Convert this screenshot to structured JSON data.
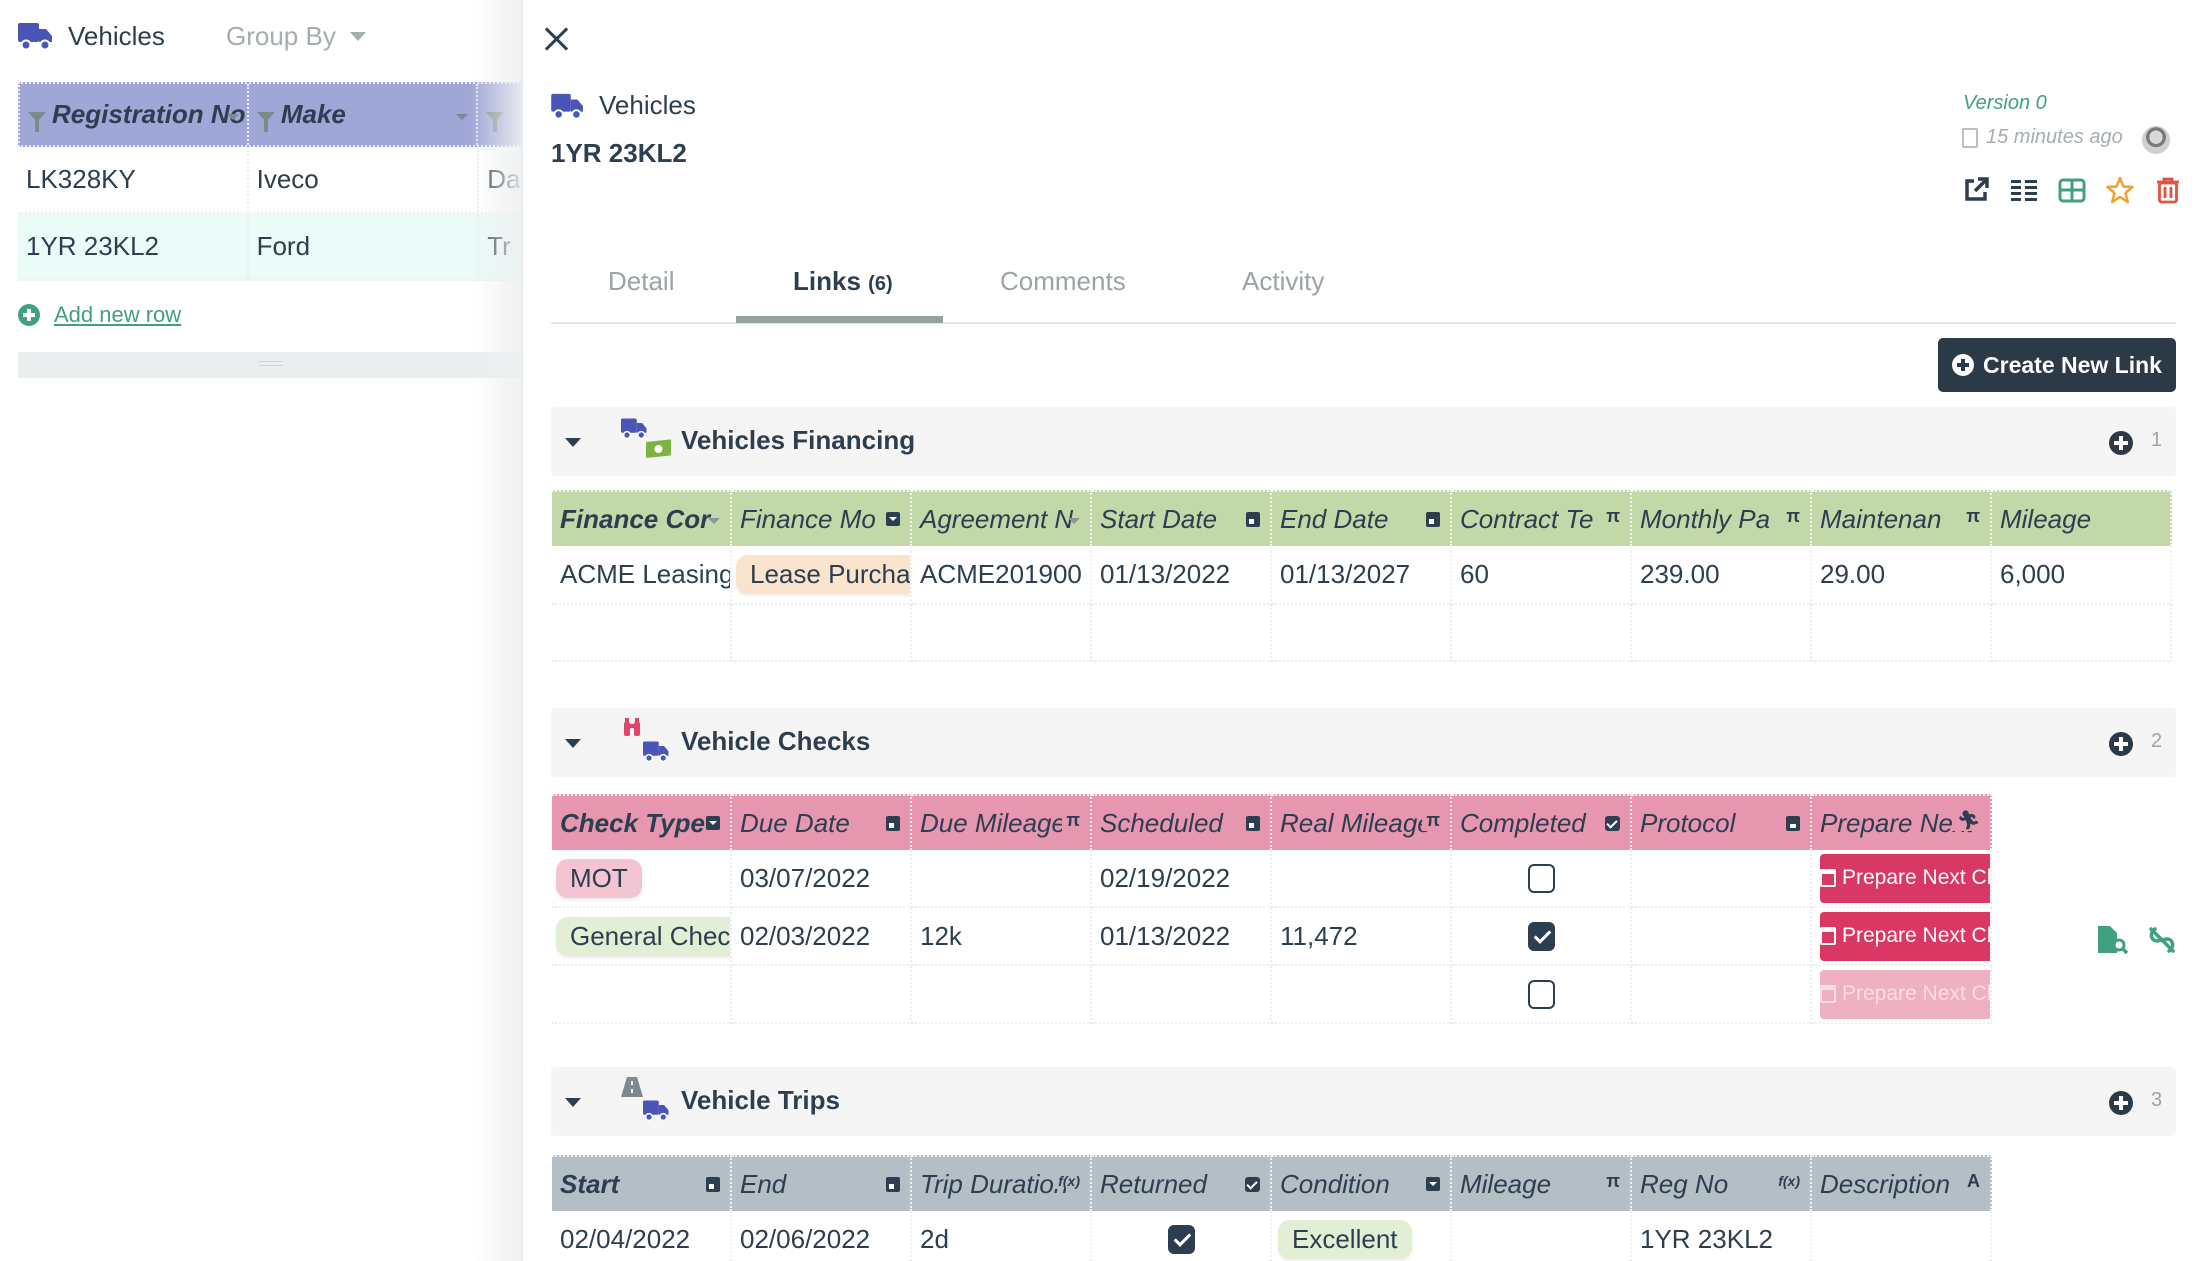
{
  "left_panel": {
    "title": "Vehicles",
    "group_by_label": "Group By",
    "columns": [
      "Registration No",
      "Make",
      ""
    ],
    "rows": [
      {
        "registration_no": "LK328KY",
        "make": "Iveco",
        "more": "Da",
        "selected": false
      },
      {
        "registration_no": "1YR 23KL2",
        "make": "Ford",
        "more": "Tr",
        "selected": true
      }
    ],
    "add_row_label": "Add new row"
  },
  "detail": {
    "table_name": "Vehicles",
    "record_title": "1YR 23KL2",
    "version_label": "Version 0",
    "updated_label": "15 minutes ago",
    "tabs": [
      {
        "label": "Detail",
        "count": "",
        "active": false
      },
      {
        "label": "Links",
        "count": "(6)",
        "active": true
      },
      {
        "label": "Comments",
        "count": "",
        "active": false
      },
      {
        "label": "Activity",
        "count": "",
        "active": false
      }
    ],
    "create_link_label": "Create New Link",
    "colors": {
      "accent_green": "#41a07d",
      "dark": "#2c3a47",
      "vehicles_blue": "#4b55b8"
    }
  },
  "sections": {
    "financing": {
      "title": "Vehicles Financing",
      "count": "1",
      "header_color": "#c3d8a9",
      "columns": [
        {
          "label": "Finance Cor",
          "icon": "dropdown"
        },
        {
          "label": "Finance Mo",
          "icon": "select"
        },
        {
          "label": "Agreement N",
          "icon": "dropdown"
        },
        {
          "label": "Start Date",
          "icon": "calendar"
        },
        {
          "label": "End Date",
          "icon": "calendar"
        },
        {
          "label": "Contract Te",
          "icon": "pi"
        },
        {
          "label": "Monthly Pa",
          "icon": "pi"
        },
        {
          "label": "Maintenan",
          "icon": "pi"
        },
        {
          "label": "Mileage",
          "icon": ""
        }
      ],
      "rows": [
        [
          "ACME Leasing",
          "Lease Purchase",
          "ACME201900",
          "01/13/2022",
          "01/13/2027",
          "60",
          "239.00",
          "29.00",
          "6,000"
        ]
      ]
    },
    "checks": {
      "title": "Vehicle Checks",
      "count": "2",
      "header_color": "#e796b0",
      "columns": [
        {
          "label": "Check Type",
          "icon": "select"
        },
        {
          "label": "Due Date",
          "icon": "calendar"
        },
        {
          "label": "Due Mileage",
          "icon": "pi"
        },
        {
          "label": "Scheduled",
          "icon": "calendar"
        },
        {
          "label": "Real Mileage",
          "icon": "pi"
        },
        {
          "label": "Completed",
          "icon": "checkbox"
        },
        {
          "label": "Protocol",
          "icon": "save"
        },
        {
          "label": "Prepare Next",
          "icon": "run"
        }
      ],
      "rows": [
        {
          "check_type": "MOT",
          "due_date": "03/07/2022",
          "due_mileage": "",
          "scheduled": "02/19/2022",
          "real_mileage": "",
          "completed": false,
          "protocol": "",
          "action": "Prepare Next Check"
        },
        {
          "check_type": "General Check",
          "due_date": "02/03/2022",
          "due_mileage": "12k",
          "scheduled": "01/13/2022",
          "real_mileage": "11,472",
          "completed": true,
          "protocol": "",
          "action": "Prepare Next Check"
        },
        {
          "check_type": "",
          "due_date": "",
          "due_mileage": "",
          "scheduled": "",
          "real_mileage": "",
          "completed": false,
          "protocol": "",
          "action": "Prepare Next Check"
        }
      ]
    },
    "trips": {
      "title": "Vehicle Trips",
      "count": "3",
      "header_color": "#b3bec5",
      "columns": [
        {
          "label": "Start",
          "icon": "calendar"
        },
        {
          "label": "End",
          "icon": "calendar"
        },
        {
          "label": "Trip Duration",
          "icon": "formula"
        },
        {
          "label": "Returned",
          "icon": "checkbox"
        },
        {
          "label": "Condition",
          "icon": "select"
        },
        {
          "label": "Mileage",
          "icon": "pi"
        },
        {
          "label": "Reg No",
          "icon": "formula"
        },
        {
          "label": "Description",
          "icon": "text"
        }
      ],
      "rows": [
        {
          "start": "02/04/2022",
          "end": "02/06/2022",
          "duration": "2d",
          "returned": true,
          "condition": "Excellent",
          "mileage": "",
          "reg_no": "1YR 23KL2",
          "description": ""
        }
      ]
    }
  }
}
